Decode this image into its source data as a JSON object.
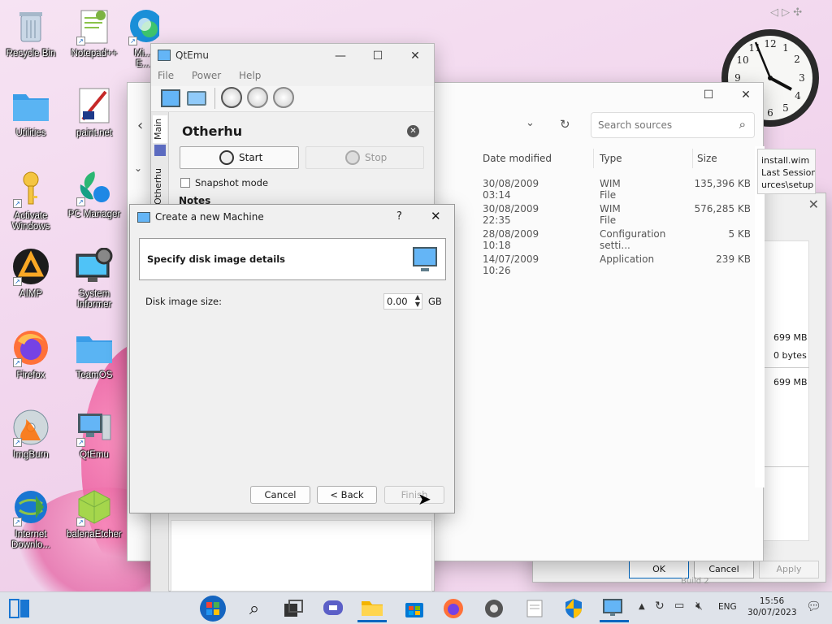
{
  "desktop": {
    "icons": [
      {
        "label": "Recycle Bin",
        "icon": "recycle-bin-icon"
      },
      {
        "label": "Notepad++",
        "icon": "notepad-plus-plus-icon"
      },
      {
        "label": "Mi...\nE...",
        "icon": "edge-icon"
      },
      {
        "label": "Utilities",
        "icon": "folder-icon"
      },
      {
        "label": "paint.net",
        "icon": "paintnet-icon"
      },
      {
        "label": "Activate\nWindows",
        "icon": "key-icon"
      },
      {
        "label": "PC Manager",
        "icon": "pc-manager-icon"
      },
      {
        "label": "AIMP",
        "icon": "aimp-icon"
      },
      {
        "label": "System\nInformer",
        "icon": "system-informer-icon"
      },
      {
        "label": "Firefox",
        "icon": "firefox-icon"
      },
      {
        "label": "TeamOS",
        "icon": "folder-icon"
      },
      {
        "label": "ImgBurn",
        "icon": "imgburn-icon"
      },
      {
        "label": "QtEmu",
        "icon": "qtemu-icon"
      },
      {
        "label": "Internet\nDownlo...",
        "icon": "idm-icon"
      },
      {
        "label": "balenaEtcher",
        "icon": "etcher-icon"
      }
    ]
  },
  "clock": {
    "icon": "analog-clock-icon"
  },
  "explorer": {
    "search_placeholder": "Search sources",
    "columns": [
      "Date modified",
      "Type",
      "Size"
    ],
    "rows": [
      {
        "date": "30/08/2009 03:14",
        "type": "WIM File",
        "size": "135,396 KB"
      },
      {
        "date": "30/08/2009 22:35",
        "type": "WIM File",
        "size": "576,285 KB"
      },
      {
        "date": "28/08/2009 10:18",
        "type": "Configuration setti...",
        "size": "5 KB"
      },
      {
        "date": "14/07/2009 10:26",
        "type": "Application",
        "size": "239 KB"
      }
    ],
    "tooltip": [
      "install.wim",
      "Last Session",
      "urces\\setup"
    ]
  },
  "props": {
    "values": [
      "699 MB",
      "0 bytes",
      "699 MB"
    ],
    "ok": "OK",
    "cancel": "Cancel",
    "apply": "Apply",
    "build": "Build 2"
  },
  "qtemu": {
    "title": "QtEmu",
    "menu": [
      "File",
      "Power",
      "Help"
    ],
    "side_tabs": [
      "Main",
      "Otherhu"
    ],
    "machine_name": "Otherhu",
    "start": "Start",
    "stop": "Stop",
    "snapshot": "Snapshot mode",
    "notes": "Notes"
  },
  "dialog": {
    "title": "Create a new Machine",
    "help": "?",
    "header": "Specify disk image details",
    "size_label": "Disk image size:",
    "size_value": "0.00",
    "unit": "GB",
    "cancel": "Cancel",
    "back": "< Back",
    "finish": "Finish"
  },
  "taskbar": {
    "lang": "ENG",
    "time": "15:56",
    "date": "30/07/2023",
    "apps": [
      "widgets-icon",
      "start-icon",
      "search-icon",
      "task-view-icon",
      "chat-icon",
      "file-explorer-icon",
      "store-icon",
      "firefox-icon",
      "settings-icon",
      "notepad-icon",
      "security-icon",
      "qtemu-icon"
    ]
  }
}
